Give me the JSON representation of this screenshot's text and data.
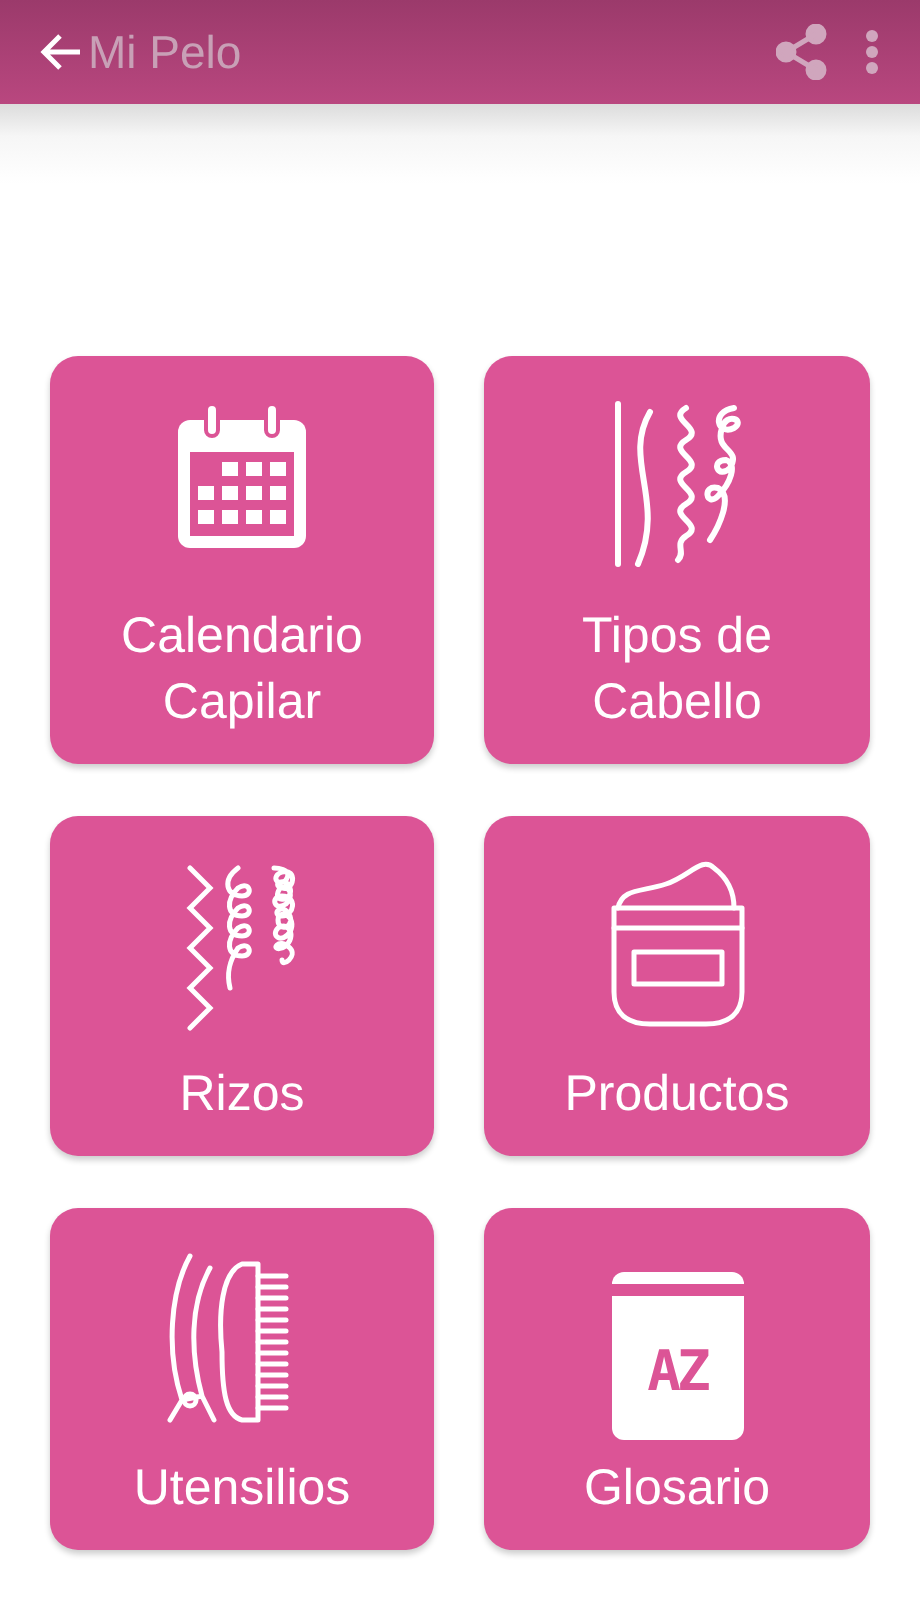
{
  "app_bar": {
    "title": "Mi Pelo"
  },
  "menu": [
    {
      "label": "Calendario Capilar"
    },
    {
      "label": "Tipos de Cabello"
    },
    {
      "label": "Rizos"
    },
    {
      "label": "Productos"
    },
    {
      "label": "Utensilios"
    },
    {
      "label": "Glosario"
    }
  ],
  "glossary_icon": {
    "letters": "AZ"
  }
}
